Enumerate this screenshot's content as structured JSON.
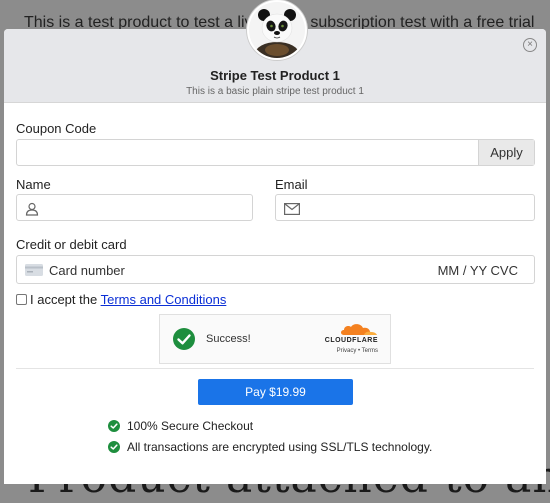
{
  "background": {
    "top_text": "This is a test product to test a live mode subscription test with a free trial",
    "heading": "Product attached to an"
  },
  "header": {
    "title": "Stripe Test Product 1",
    "subtitle": "This is a basic plain stripe test product 1",
    "close_glyph": "×"
  },
  "coupon": {
    "label": "Coupon Code",
    "value": "",
    "apply_label": "Apply"
  },
  "name": {
    "label": "Name",
    "value": ""
  },
  "email": {
    "label": "Email",
    "value": ""
  },
  "card": {
    "label": "Credit or debit card",
    "placeholder": "Card number",
    "expiry_cvc": "MM / YY  CVC"
  },
  "terms": {
    "prefix": "I accept the ",
    "link": "Terms and Conditions"
  },
  "captcha": {
    "status": "Success!",
    "brand": "CLOUDFLARE",
    "links": "Privacy • Terms"
  },
  "pay": {
    "label": "Pay $19.99"
  },
  "features": [
    "100% Secure Checkout",
    "All transactions are encrypted using SSL/TLS technology."
  ],
  "colors": {
    "accent": "#1a74e8",
    "success": "#1e8e3e",
    "cloudflare_orange": "#f48120"
  }
}
